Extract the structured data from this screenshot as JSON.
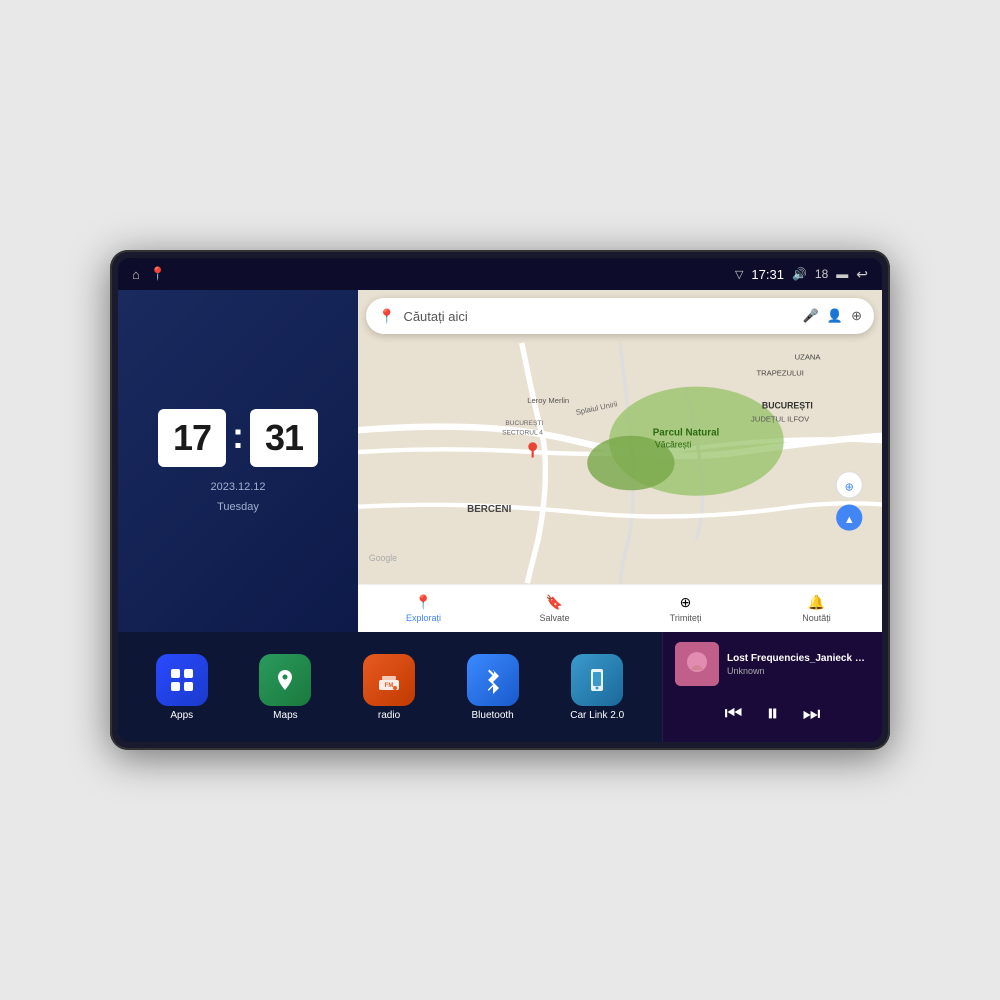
{
  "device": {
    "status_bar": {
      "left_icons": [
        "home",
        "maps"
      ],
      "time": "17:31",
      "signal_icon": "signal",
      "volume_icon": "volume",
      "volume_level": "18",
      "battery_icon": "battery",
      "back_icon": "back"
    },
    "clock": {
      "hours": "17",
      "minutes": "31",
      "date": "2023.12.12",
      "day": "Tuesday"
    },
    "map": {
      "search_placeholder": "Căutați aici",
      "nav_items": [
        {
          "label": "Explorați",
          "icon": "📍",
          "active": true
        },
        {
          "label": "Salvate",
          "icon": "🔖",
          "active": false
        },
        {
          "label": "Trimiteți",
          "icon": "⊕",
          "active": false
        },
        {
          "label": "Noutăți",
          "icon": "🔔",
          "active": false
        }
      ],
      "locations": [
        "Parcul Natural Văcărești",
        "BUCUREȘTI",
        "JUDEȚUL ILFOV",
        "BERCENI",
        "Leroy Merlin",
        "BUCUREȘTI SECTORUL 4",
        "TRAPEZULUI",
        "UZANA"
      ]
    },
    "apps": [
      {
        "id": "apps",
        "label": "Apps",
        "icon": "⊞",
        "icon_class": "icon-apps"
      },
      {
        "id": "maps",
        "label": "Maps",
        "icon": "🗺",
        "icon_class": "icon-maps"
      },
      {
        "id": "radio",
        "label": "radio",
        "icon": "📻",
        "icon_class": "icon-radio"
      },
      {
        "id": "bluetooth",
        "label": "Bluetooth",
        "icon": "🔷",
        "icon_class": "icon-bluetooth"
      },
      {
        "id": "carlink",
        "label": "Car Link 2.0",
        "icon": "📱",
        "icon_class": "icon-carlink"
      }
    ],
    "music": {
      "title": "Lost Frequencies_Janieck Devy-...",
      "artist": "Unknown",
      "controls": {
        "prev": "⏮",
        "play": "⏸",
        "next": "⏭"
      }
    }
  }
}
